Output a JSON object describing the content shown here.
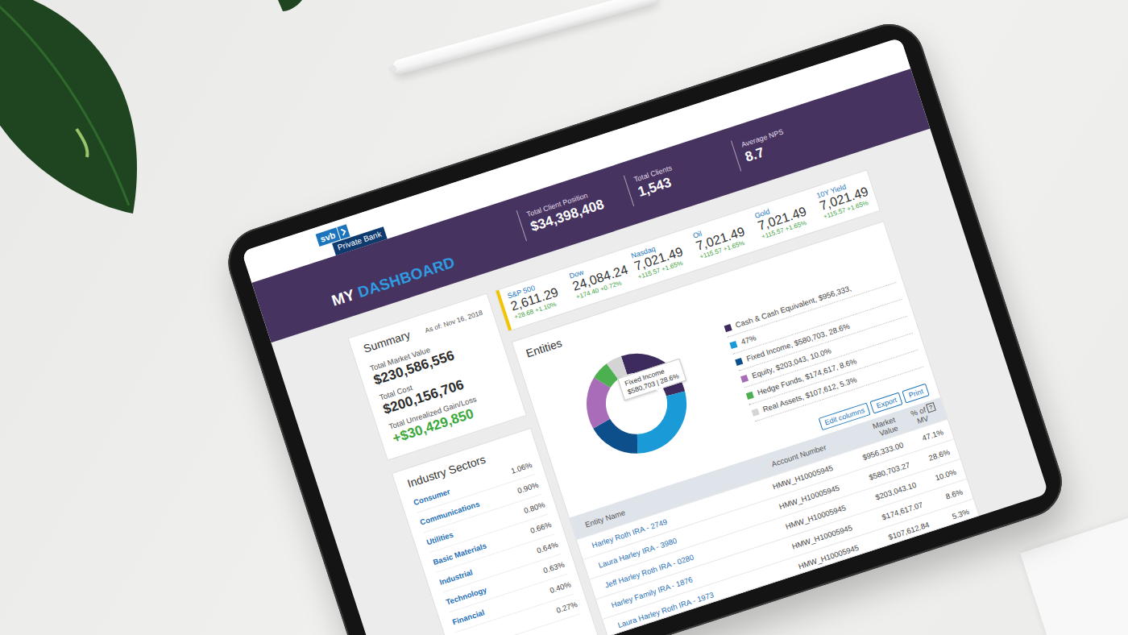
{
  "header": {
    "logo": {
      "mark": "svb",
      "name": "Private Bank"
    },
    "title_prefix": "MY",
    "title": "DASHBOARD",
    "stats": [
      {
        "label": "Total Client Position",
        "value": "$34,398,408"
      },
      {
        "label": "Total Clients",
        "value": "1,543"
      },
      {
        "label": "Average NPS",
        "value": "8.7"
      }
    ]
  },
  "summary": {
    "title": "Summary",
    "as_of": "As of: Nov 16, 2018",
    "items": [
      {
        "label": "Total Market Value",
        "value": "$230,586,556",
        "positive": false
      },
      {
        "label": "Total Cost",
        "value": "$200,156,706",
        "positive": false
      },
      {
        "label": "Total Unrealized Gain/Loss",
        "value": "+$30,429,850",
        "positive": true
      }
    ]
  },
  "industry_sectors": {
    "title": "Industry Sectors",
    "items": [
      {
        "name": "Consumer",
        "value": "1.06%"
      },
      {
        "name": "Communications",
        "value": "0.90%"
      },
      {
        "name": "Utilities",
        "value": "0.80%"
      },
      {
        "name": "Basic Materials",
        "value": "0.66%"
      },
      {
        "name": "Industrial",
        "value": "0.64%"
      },
      {
        "name": "Technology",
        "value": "0.63%"
      },
      {
        "name": "Financial",
        "value": "0.40%"
      },
      {
        "name": "",
        "value": "0.27%"
      }
    ]
  },
  "ticker": [
    {
      "label": "S&P 500",
      "value": "2,611.29",
      "change": "+28.68 +1.10%",
      "selected": true
    },
    {
      "label": "Dow",
      "value": "24,084.24",
      "change": "+174.40 +0.72%",
      "selected": false
    },
    {
      "label": "Nasdaq",
      "value": "7,021.49",
      "change": "+115.57 +1.65%",
      "selected": false
    },
    {
      "label": "Oil",
      "value": "7,021.49",
      "change": "+115.57 +1.65%",
      "selected": false
    },
    {
      "label": "Gold",
      "value": "7,021.49",
      "change": "+115.57 +1.65%",
      "selected": false
    },
    {
      "label": "10Y Yield",
      "value": "7,021.49",
      "change": "+115.57 +1.65%",
      "selected": false
    }
  ],
  "entities": {
    "title": "Entities",
    "chart": {
      "segments": [
        {
          "value": 26,
          "color": "#3d2b5e"
        },
        {
          "value": 28.6,
          "color": "#1b9ad8"
        },
        {
          "value": 17,
          "color": "#0d4f8b"
        },
        {
          "value": 17,
          "color": "#a96cb8"
        },
        {
          "value": 6,
          "color": "#4caf50"
        },
        {
          "value": 5.4,
          "color": "#d4d4d4"
        }
      ],
      "tooltip": {
        "title": "Fixed Income",
        "value": "$580,703 | 28.6%"
      }
    },
    "legend": [
      {
        "label": "Cash & Cash Equivalent, $956,333,",
        "color": "#3d2b5e"
      },
      {
        "label": "47%",
        "color": "#1b9ad8"
      },
      {
        "label": "Fixed Income, $580,703, 28.6%",
        "color": "#0d4f8b"
      },
      {
        "label": "Equity, $203,043, 10.0%",
        "color": "#a96cb8"
      },
      {
        "label": "Hedge Funds, $174,617, 8.6%",
        "color": "#4caf50"
      },
      {
        "label": "Real Assets, $107,612, 5.3%",
        "color": "#d4d4d4"
      }
    ],
    "buttons": [
      "Edit columns",
      "Export",
      "Print"
    ],
    "table": {
      "columns": [
        "Entity Name",
        "Account Number",
        "Market Value",
        "% of MV"
      ],
      "help": "?",
      "rows": [
        {
          "entity": "Harley Roth IRA - 2749",
          "account": "HMW_H10005945",
          "market_value": "$956,333.00",
          "pct": "47.1%"
        },
        {
          "entity": "Laura Harley IRA - 3980",
          "account": "HMW_H10005945",
          "market_value": "$580,703.27",
          "pct": "28.6%"
        },
        {
          "entity": "Jeff Harley Roth IRA - 0280",
          "account": "HMW_H10005945",
          "market_value": "$203,043.10",
          "pct": "10.0%"
        },
        {
          "entity": "Harley Family IRA - 1876",
          "account": "HMW_H10005945",
          "market_value": "$174,617.07",
          "pct": "8.6%"
        },
        {
          "entity": "Laura Harley Roth IRA - 1973",
          "account": "HMW_H10005945",
          "market_value": "$107,612.84",
          "pct": "5.3%"
        }
      ]
    }
  }
}
